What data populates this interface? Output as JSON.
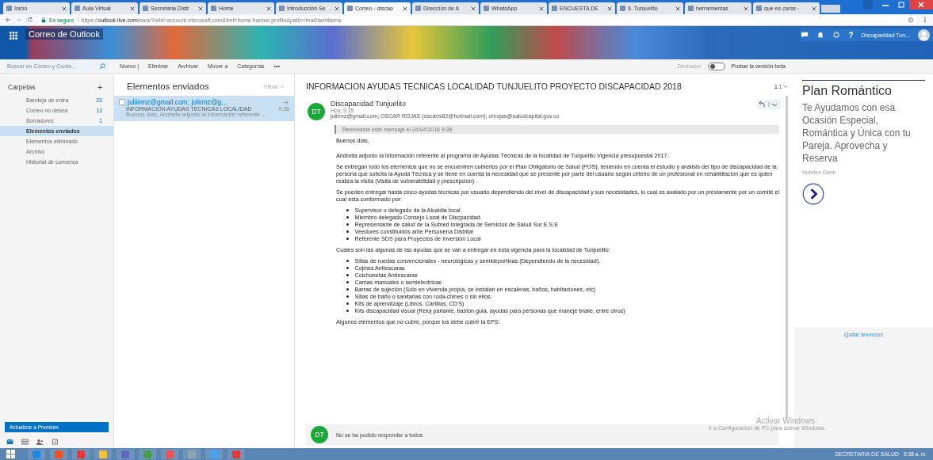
{
  "browser": {
    "tabs": [
      {
        "label": "Inicio",
        "selected": false
      },
      {
        "label": "Aula Virtual",
        "selected": false
      },
      {
        "label": "Secretaria Distr",
        "selected": false
      },
      {
        "label": "Home",
        "selected": false
      },
      {
        "label": "Introducción Se",
        "selected": false
      },
      {
        "label": "Correo - discap",
        "selected": true
      },
      {
        "label": "Dirección de A",
        "selected": false
      },
      {
        "label": "WhatsApp",
        "selected": false
      },
      {
        "label": "ENCUESTA DE",
        "selected": false
      },
      {
        "label": "6. Tunjuelito",
        "selected": false
      },
      {
        "label": "herramientas",
        "selected": false
      },
      {
        "label": "que es corse -",
        "selected": false
      }
    ],
    "secure_label": "Es seguro",
    "url_host": "outlook.live.com",
    "url_rest": "/owa/?refd=account.microsoft.com&fref=home.banner.profile&path=/mail/sentitems",
    "url_scheme": "https://"
  },
  "app": {
    "title": "Correo de Outlook",
    "user": "Discapacidad Tun...",
    "help": "?"
  },
  "search": {
    "placeholder": "Buscar en Correo y Conta..."
  },
  "toolbar": {
    "items": [
      "Nuevo |",
      "Eliminar",
      "Archivar",
      "Mover a",
      "Categorías",
      "•••"
    ],
    "undo": {
      "label": "Deshacer",
      "disabled": true
    },
    "beta_toggle": {
      "on": false,
      "label": "Probar la versión beta"
    }
  },
  "folders": {
    "header": "Carpetas",
    "add": "+",
    "items": [
      {
        "name": "Bandeja de entra",
        "count": "23",
        "selected": false
      },
      {
        "name": "Correo no desea",
        "count": "13",
        "selected": false
      },
      {
        "name": "Borradores",
        "count": "1",
        "selected": false
      },
      {
        "name": "Elementos enviados",
        "selected": true
      },
      {
        "name": "Elementos eliminado",
        "selected": false
      },
      {
        "name": "Archivo",
        "selected": false
      },
      {
        "name": "Historial de conversa",
        "selected": false
      }
    ],
    "premium": "Actualizar a Premium"
  },
  "message_list": {
    "title": "Elementos enviados",
    "filter": "Filtrar",
    "messages": [
      {
        "to": "juliiirmz@gmail.com; julirmz@g...",
        "subject": "INFORMACION AYUDAS TECNICAS LOCALIDAD",
        "time": "9:38",
        "preview": "Buenos días,  Andreita adjunto la información referente ...",
        "selected": true
      }
    ]
  },
  "reading": {
    "subject": "INFORMACION AYUDAS TECNICAS LOCALIDAD TUNJUELITO PROYECTO DISCAPACIDAD 2018",
    "people_count": "1",
    "initials": "DT",
    "sender": "Discapacidad Tunjuelito",
    "date": "Hoy, 9:35",
    "recipients": "julirmz@gmail.com; OSCAR ROJAS (oscarrs82@hotmail.com); ohrojas@saludcapital.gov.co",
    "forward_note": "Reenviaste este mensaje el 24/04/2018 9:38",
    "body": [
      {
        "kind": "p",
        "text": "Buenos días,"
      },
      {
        "kind": "gap"
      },
      {
        "kind": "p",
        "text": "Andreita adjunto la información referente al programa de Ayudas Técnicas de la localidad de Tunjuelito Vigencia presupuestal 2017."
      },
      {
        "kind": "p",
        "text": "Se entregan todo los elementos que no se encuentren cubiertos por el Plan Obligatorio de Salud (POS), teniendo en cuenta el estudio y análisis del tipo de discapacidad de la persona que solicita la Ayuda Técnica y se tiene en cuenta la necesidad que se presente por parte del usuario según criterio de un profesional en rehabilitación que es quien realiza la visita (Visita de vulnerabilidad y prescripción) ."
      },
      {
        "kind": "p",
        "text": "Se pueden entregar hasta cinco ayudas técnicas por usuario dependiendo  del nivel de discapacidad y sus necesidades, lo cual es avalado por un previamente por un comité el cual esta conformado por:"
      },
      {
        "kind": "list",
        "items": [
          "Supervisor o delegado de la Alcaldia local",
          "Miembro delegado Consejo Local de Discpacidad",
          "Representante de salud de la Subred Integrada de Servicios de Salud  Sur E.S.E",
          "Veedores constituidos ante Personería Distrital",
          "Referente SDS para Proyectos de Inversión Local"
        ]
      },
      {
        "kind": "p",
        "text": "Cuales son las algunas de las ayudas que se van a entregar en esta vigencia para la localidad de Tunjuelito:"
      },
      {
        "kind": "list",
        "items": [
          "Sillas de ruedas convencionales - neurológicas y semideportivas (Dependiendo de la necesidad).",
          "Cojines Antiescaras",
          "Colchonetas Antiescaras",
          "Camas manuales o semielectricas",
          "Barras de sujeción (Solo en vivienda propia, se instalan en escaleras, baños, habitaciones, etc)",
          "Sillas de baño o sanitarias con roda-chines o sin ellos.",
          "Kits de aprendizaje (Libros, Cartillas, CD'S)",
          "Kits discapacidad visual (Reloj parlante, bastón guia, ayudas para personas que maneje braile, entre otros)"
        ]
      },
      {
        "kind": "p",
        "text": "Algunos elementos que no cubre, porque los debe cubrir la EPS:"
      }
    ],
    "reply_initials": "DT",
    "reply_notice": "No se ha podido responder a todos"
  },
  "ad": {
    "title": "Plan Romántico",
    "text": "Te Ayudamos con esa Ocasión Especial, Romántica y Única con tu Pareja. Aprovecha y Reserva",
    "advertiser": "Hoteles Dann",
    "remove": "Quitar anuncios"
  },
  "activation": {
    "title": "Activar Windows",
    "text": "Ir a Configuración de PC para activar Windows."
  },
  "taskbar": {
    "user": "SECRETARIA DE SALUD",
    "time": "9:38 a. m."
  }
}
